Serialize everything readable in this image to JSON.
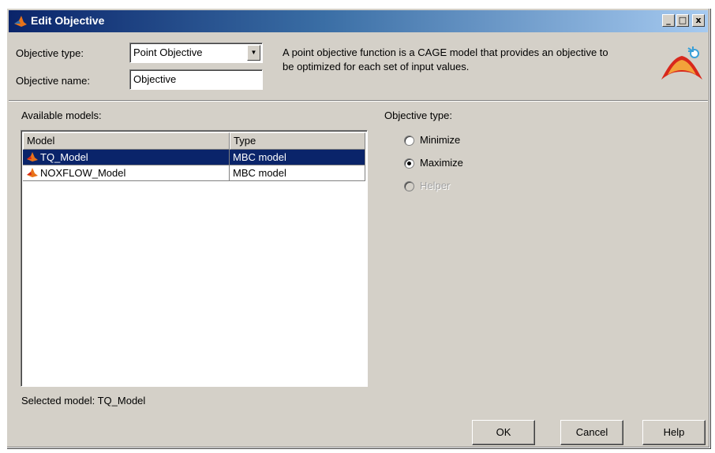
{
  "window": {
    "title": "Edit Objective",
    "controls": [
      "_",
      "□",
      "x"
    ]
  },
  "form": {
    "objective_type_label": "Objective type:",
    "objective_type_value": "Point Objective",
    "objective_name_label": "Objective name:",
    "objective_name_value": "Objective",
    "description": "A point objective function is a CAGE model that provides an objective to be optimized for each set of input values."
  },
  "models": {
    "label": "Available models:",
    "columns": [
      "Model",
      "Type"
    ],
    "rows": [
      {
        "model": "TQ_Model",
        "type": "MBC model",
        "selected": true
      },
      {
        "model": "NOXFLOW_Model",
        "type": "MBC model",
        "selected": false
      }
    ],
    "selected_text": "Selected model: TQ_Model"
  },
  "objective_kind": {
    "label": "Objective type:",
    "options": [
      {
        "label": "Minimize",
        "checked": false,
        "enabled": true
      },
      {
        "label": "Maximize",
        "checked": true,
        "enabled": true
      },
      {
        "label": "Helper",
        "checked": false,
        "enabled": false
      }
    ]
  },
  "buttons": {
    "ok": "OK",
    "cancel": "Cancel",
    "help": "Help"
  },
  "colors": {
    "selection": "#0a246a",
    "dialog_bg": "#d4d0c8"
  }
}
